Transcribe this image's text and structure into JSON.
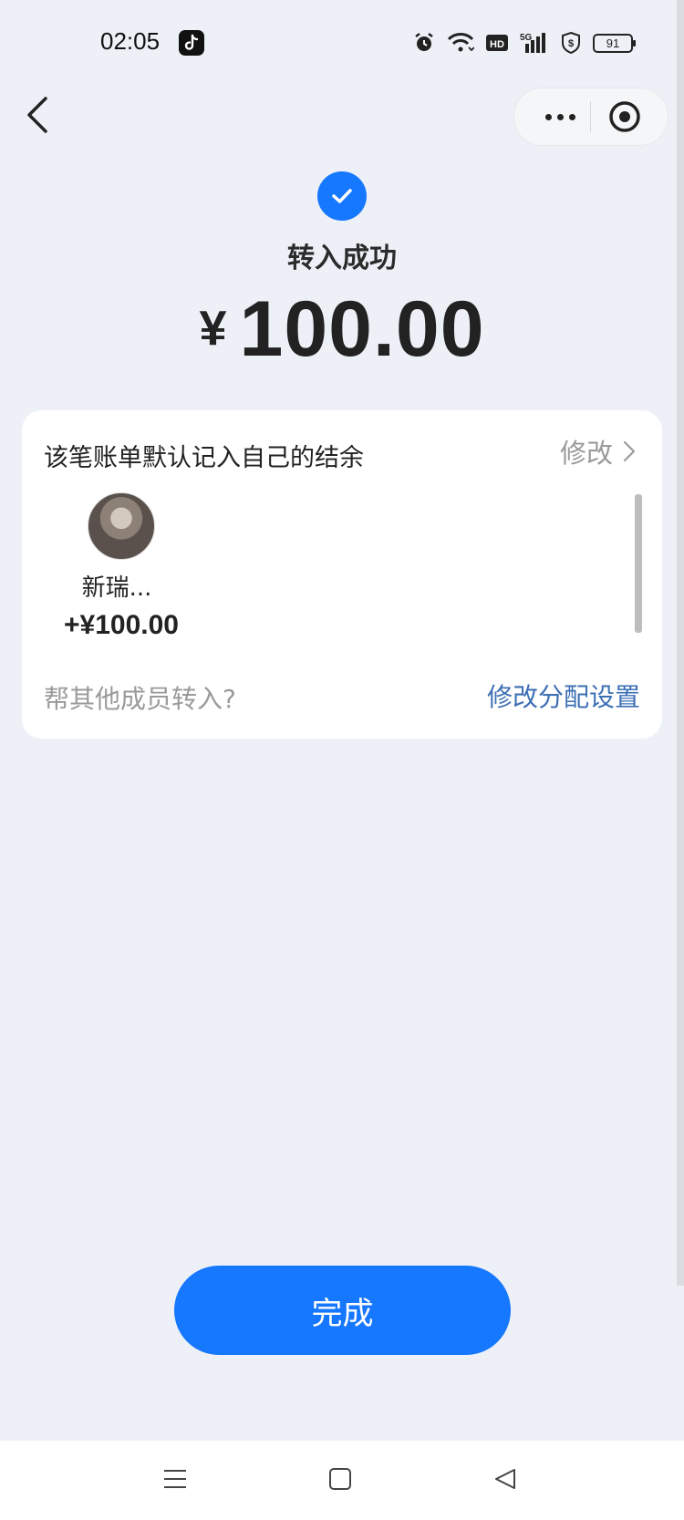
{
  "status_bar": {
    "time": "02:05",
    "battery": "91",
    "icons": [
      "tiktok-icon",
      "alarm-icon",
      "wifi-icon",
      "hd-icon",
      "5g-signal-icon",
      "shield-dollar-icon",
      "battery-icon"
    ]
  },
  "nav": {
    "back_icon": "chevron-left-icon",
    "more_icon": "more-dots-icon",
    "close_icon": "record-circle-icon"
  },
  "result": {
    "title": "转入成功",
    "currency": "¥",
    "amount": "100.00"
  },
  "card": {
    "title": "该笔账单默认记入自己的结余",
    "modify_label": "修改",
    "members": [
      {
        "name": "新瑞...",
        "amount": "+¥100.00"
      }
    ],
    "help_text": "帮其他成员转入?",
    "allocation_link": "修改分配设置"
  },
  "actions": {
    "done_label": "完成"
  },
  "colors": {
    "primary": "#1677ff",
    "background": "#edf1f7",
    "link": "#3d6fb4"
  }
}
